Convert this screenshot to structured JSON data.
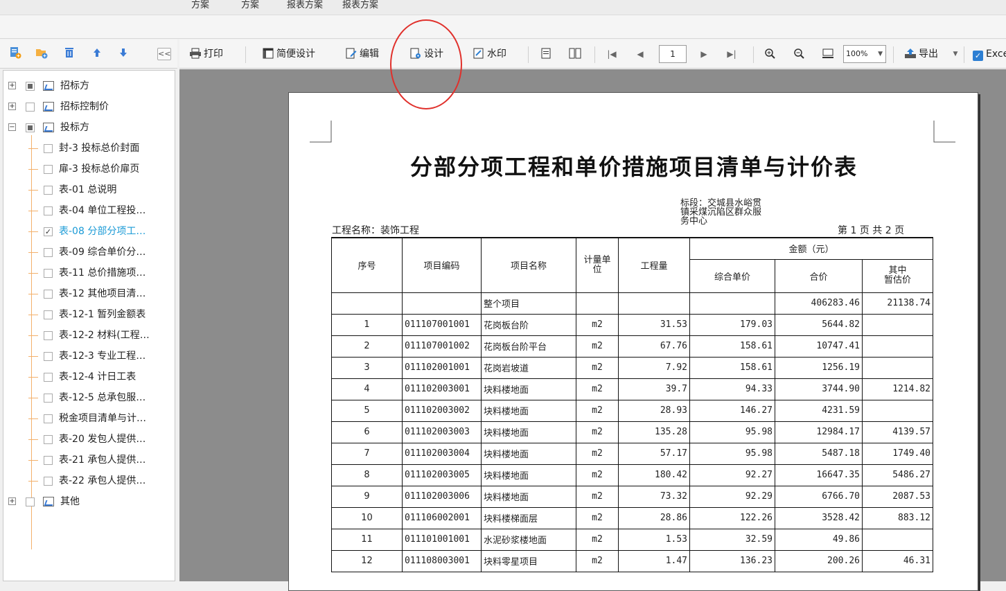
{
  "top_strip": {
    "items": [
      "方案",
      "方案",
      "报表方案",
      "报表方案"
    ]
  },
  "left_toolbar": {
    "icons": [
      "add-report-icon",
      "add-folder-icon",
      "delete-icon",
      "move-up-icon",
      "move-down-icon"
    ],
    "collapse_label": "<<"
  },
  "tree": {
    "nodes": [
      {
        "label": "招标方",
        "level": 0
      },
      {
        "label": "招标控制价",
        "level": 0
      },
      {
        "label": "投标方",
        "level": 0
      },
      {
        "label": "封-3 投标总价封面",
        "level": 1
      },
      {
        "label": "扉-3 投标总价扉页",
        "level": 1
      },
      {
        "label": "表-01 总说明",
        "level": 1
      },
      {
        "label": "表-04 单位工程投…",
        "level": 1
      },
      {
        "label": "表-08 分部分项工…",
        "level": 1,
        "checked": true,
        "selected": true
      },
      {
        "label": "表-09 综合单价分…",
        "level": 1
      },
      {
        "label": "表-11 总价措施项…",
        "level": 1
      },
      {
        "label": "表-12 其他项目清…",
        "level": 1
      },
      {
        "label": "表-12-1 暂列金额表",
        "level": 1
      },
      {
        "label": "表-12-2 材料(工程…",
        "level": 1
      },
      {
        "label": "表-12-3 专业工程…",
        "level": 1
      },
      {
        "label": "表-12-4 计日工表",
        "level": 1
      },
      {
        "label": "表-12-5 总承包服…",
        "level": 1
      },
      {
        "label": "税金项目清单与计…",
        "level": 1
      },
      {
        "label": "表-20 发包人提供…",
        "level": 1
      },
      {
        "label": "表-21 承包人提供…",
        "level": 1
      },
      {
        "label": "表-22 承包人提供…",
        "level": 1
      },
      {
        "label": "其他",
        "level": 0
      }
    ]
  },
  "main_toolbar": {
    "print": "打印",
    "simple_design": "简便设计",
    "edit": "编辑",
    "design": "设计",
    "watermark": "水印",
    "page": "1",
    "zoom": "100%",
    "export": "导出",
    "excel": "Exce"
  },
  "report": {
    "title": "分部分项工程和单价措施项目清单与计价表",
    "project_label": "工程名称：装饰工程",
    "bid_section": [
      "标段：交城县水峪贯",
      "镇采煤沉陷区群众服",
      "务中心"
    ],
    "page_info": "第 1 页  共 2 页",
    "headers": {
      "seq": "序号",
      "code": "项目编码",
      "name": "项目名称",
      "unit_l1": "计量单",
      "unit_l2": "位",
      "qty": "工程量",
      "amount": "金额（元）",
      "unit_price": "综合单价",
      "total": "合价",
      "est_l1": "其中",
      "est_l2": "暂估价"
    },
    "summary": {
      "name": "整个项目",
      "total": "406283.46",
      "est": "21138.74"
    },
    "rows": [
      {
        "seq": "1",
        "code": "011107001001",
        "name": "花岗板台阶",
        "unit": "m2",
        "qty": "31.53",
        "price": "179.03",
        "total": "5644.82",
        "est": ""
      },
      {
        "seq": "2",
        "code": "011107001002",
        "name": "花岗板台阶平台",
        "unit": "m2",
        "qty": "67.76",
        "price": "158.61",
        "total": "10747.41",
        "est": ""
      },
      {
        "seq": "3",
        "code": "011102001001",
        "name": "花岗岩坡道",
        "unit": "m2",
        "qty": "7.92",
        "price": "158.61",
        "total": "1256.19",
        "est": ""
      },
      {
        "seq": "4",
        "code": "011102003001",
        "name": "块料楼地面",
        "unit": "m2",
        "qty": "39.7",
        "price": "94.33",
        "total": "3744.90",
        "est": "1214.82"
      },
      {
        "seq": "5",
        "code": "011102003002",
        "name": "块料楼地面",
        "unit": "m2",
        "qty": "28.93",
        "price": "146.27",
        "total": "4231.59",
        "est": ""
      },
      {
        "seq": "6",
        "code": "011102003003",
        "name": "块料楼地面",
        "unit": "m2",
        "qty": "135.28",
        "price": "95.98",
        "total": "12984.17",
        "est": "4139.57"
      },
      {
        "seq": "7",
        "code": "011102003004",
        "name": "块料楼地面",
        "unit": "m2",
        "qty": "57.17",
        "price": "95.98",
        "total": "5487.18",
        "est": "1749.40"
      },
      {
        "seq": "8",
        "code": "011102003005",
        "name": "块料楼地面",
        "unit": "m2",
        "qty": "180.42",
        "price": "92.27",
        "total": "16647.35",
        "est": "5486.27"
      },
      {
        "seq": "9",
        "code": "011102003006",
        "name": "块料楼地面",
        "unit": "m2",
        "qty": "73.32",
        "price": "92.29",
        "total": "6766.70",
        "est": "2087.53"
      },
      {
        "seq": "10",
        "code": "011106002001",
        "name": "块料楼梯面层",
        "unit": "m2",
        "qty": "28.86",
        "price": "122.26",
        "total": "3528.42",
        "est": "883.12"
      },
      {
        "seq": "11",
        "code": "011101001001",
        "name": "水泥砂浆楼地面",
        "unit": "m2",
        "qty": "1.53",
        "price": "32.59",
        "total": "49.86",
        "est": ""
      },
      {
        "seq": "12",
        "code": "011108003001",
        "name": "块料零星项目",
        "unit": "m2",
        "qty": "1.47",
        "price": "136.23",
        "total": "200.26",
        "est": "46.31"
      }
    ]
  }
}
